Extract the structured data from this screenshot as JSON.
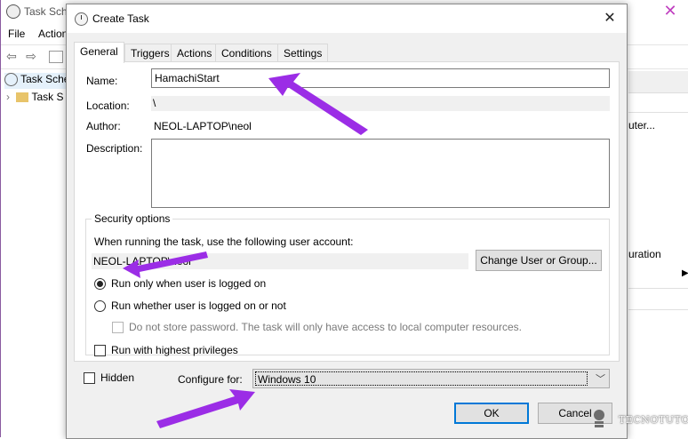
{
  "background_window": {
    "title": "Task Sche",
    "menu": [
      "File",
      "Action"
    ],
    "tree": [
      "Task Sche",
      "Task S"
    ],
    "right_panel": [
      "uter...",
      "uration"
    ]
  },
  "dialog": {
    "title": "Create Task",
    "tabs": [
      "General",
      "Triggers",
      "Actions",
      "Conditions",
      "Settings"
    ],
    "active_tab": "General",
    "name_label": "Name:",
    "name_value": "HamachiStart",
    "location_label": "Location:",
    "location_value": "\\",
    "author_label": "Author:",
    "author_value": "NEOL-LAPTOP\\neol",
    "description_label": "Description:",
    "description_value": "",
    "security": {
      "legend": "Security options",
      "account_prompt": "When running the task, use the following user account:",
      "account_value": "NEOL-LAPTOP\\neol",
      "change_user_button": "Change User or Group...",
      "radio_logged_on": "Run only when user is logged on",
      "radio_whether": "Run whether user is logged on or not",
      "selected_radio": "Run only when user is logged on",
      "no_store_password": "Do not store password.  The task will only have access to local computer resources.",
      "highest_privileges": "Run with highest privileges"
    },
    "hidden_label": "Hidden",
    "configure_for_label": "Configure for:",
    "configure_for_value": "Windows 10",
    "ok_button": "OK",
    "cancel_button": "Cancel"
  },
  "annotation_color": "#9b2de6",
  "watermark": {
    "text": "TECNOTUTO"
  }
}
